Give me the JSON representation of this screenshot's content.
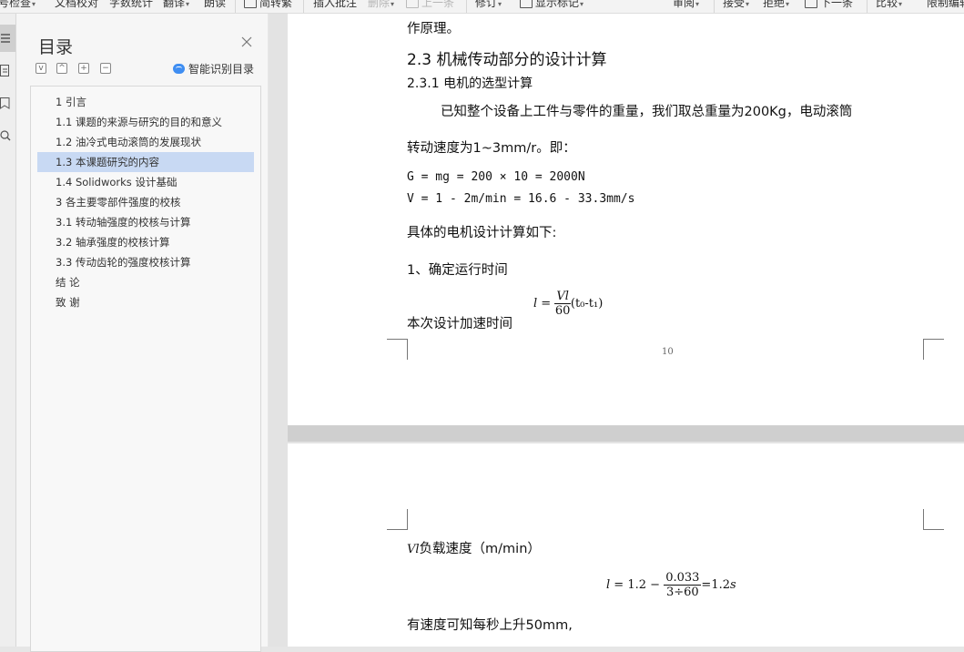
{
  "toolbar": {
    "items": [
      {
        "label": "号检查",
        "caret": true,
        "disabled": false
      },
      {
        "label": "文档校对",
        "caret": false,
        "disabled": false
      },
      {
        "label": "字数统计",
        "caret": false,
        "disabled": false
      },
      {
        "label": "翻译",
        "caret": true,
        "disabled": false
      },
      {
        "label": "朗读",
        "caret": false,
        "disabled": false
      },
      {
        "label": "简转繁",
        "caret": false,
        "disabled": false
      },
      {
        "label": "插入批注",
        "caret": false,
        "disabled": false
      },
      {
        "label": "删除",
        "caret": true,
        "disabled": true
      },
      {
        "label": "上一条",
        "caret": false,
        "disabled": true
      },
      {
        "label": "修订",
        "caret": true,
        "disabled": false
      },
      {
        "label": "显示标记",
        "caret": true,
        "disabled": false
      },
      {
        "label": "审阅",
        "caret": true,
        "disabled": false
      },
      {
        "label": "接受",
        "caret": true,
        "disabled": false
      },
      {
        "label": "拒绝",
        "caret": true,
        "disabled": false
      },
      {
        "label": "下一条",
        "caret": false,
        "disabled": false
      },
      {
        "label": "比较",
        "caret": true,
        "disabled": false
      },
      {
        "label": "限制编辑",
        "caret": false,
        "disabled": false
      }
    ]
  },
  "rail": {
    "icons": [
      "toc-icon",
      "page-outline-icon",
      "bookmark-icon",
      "find-icon"
    ]
  },
  "toc": {
    "title": "目录",
    "smart_label": "智能识别目录",
    "controls": [
      "v",
      "^",
      "+",
      "−"
    ],
    "items": [
      {
        "label": "1 引言",
        "selected": false
      },
      {
        "label": "1.1  课题的来源与研究的目的和意义",
        "selected": false
      },
      {
        "label": "1.2  油冷式电动滚筒的发展现状",
        "selected": false
      },
      {
        "label": "1.3  本课题研究的内容",
        "selected": true
      },
      {
        "label": "1.4 Solidworks 设计基础",
        "selected": false
      },
      {
        "label": "3 各主要零部件强度的校核",
        "selected": false
      },
      {
        "label": "3.1  转动轴强度的校核与计算",
        "selected": false
      },
      {
        "label": "3.2  轴承强度的校核计算",
        "selected": false
      },
      {
        "label": "3.3  传动齿轮的强度校核计算",
        "selected": false
      },
      {
        "label": "结      论",
        "selected": false
      },
      {
        "label": "致      谢",
        "selected": false
      }
    ]
  },
  "document": {
    "page1": {
      "top_fragment": "作原理。",
      "heading": "2.3 机械传动部分的设计计算",
      "subheading": "2.3.1 电机的选型计算",
      "para1_line1": "已知整个设备上工件与零件的重量，我们取总重量为200Kg，电动滚筒",
      "para1_line2": "转动速度为1~3mm/r。即：",
      "formula1": "G = mg = 200 × 10 = 2000N",
      "formula2": "V = 1 - 2m/min = 16.6 - 33.3mm/s",
      "para2": "具体的电机设计计算如下:",
      "para3": "1、确定运行时间",
      "para4": "本次设计加速时间",
      "eq_lhs": "l",
      "eq_num": "Vl",
      "eq_den": "60",
      "eq_tail": "(t₀-t₁)",
      "page_number": "10"
    },
    "page2": {
      "line1_var": "Vl",
      "line1_text": "负载速度（m/min）",
      "eq_lhs": "l",
      "eq_a": "1.2",
      "eq_num": "0.033",
      "eq_den": "3÷60",
      "eq_res": "=1.2",
      "eq_unit": "s",
      "line2": "有速度可知每秒上升50mm,"
    }
  }
}
